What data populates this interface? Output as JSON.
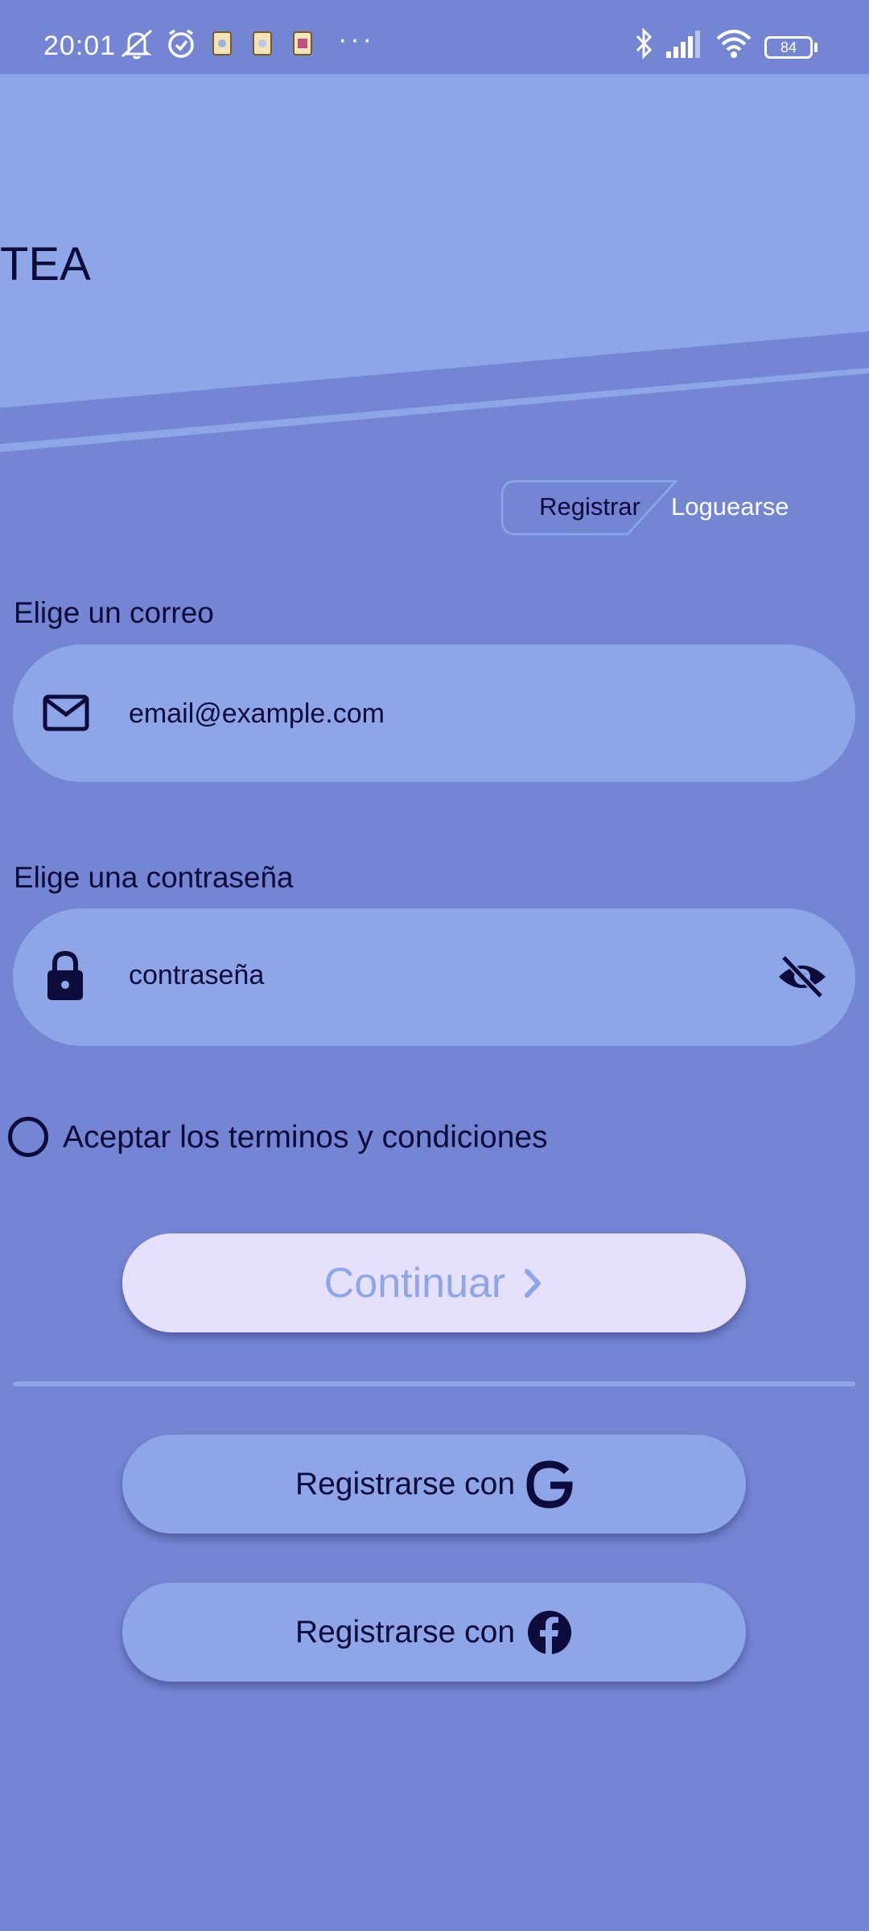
{
  "status_bar": {
    "time": "20:01",
    "battery": "84",
    "dots": "···"
  },
  "header": {
    "title": "TEA"
  },
  "tabs": {
    "register_label": "Registrar",
    "login_label": "Loguearse",
    "active": "register"
  },
  "email": {
    "label": "Elige un correo",
    "placeholder": "email@example.com",
    "value": "",
    "icon": "mail-icon"
  },
  "password": {
    "label": "Elige una contraseña",
    "placeholder": "contraseña",
    "value": "",
    "icon": "lock-icon",
    "toggle_icon": "visibility-off-icon"
  },
  "terms": {
    "label": "Aceptar los terminos y condiciones",
    "checked": false
  },
  "continue": {
    "label": "Continuar"
  },
  "social": {
    "google_label": "Registrarse con",
    "facebook_label": "Registrarse con"
  },
  "colors": {
    "background": "#7485d3",
    "surface": "#8ea6e8",
    "text_dark": "#0d0b3a",
    "button_light": "#e5e1fd"
  }
}
